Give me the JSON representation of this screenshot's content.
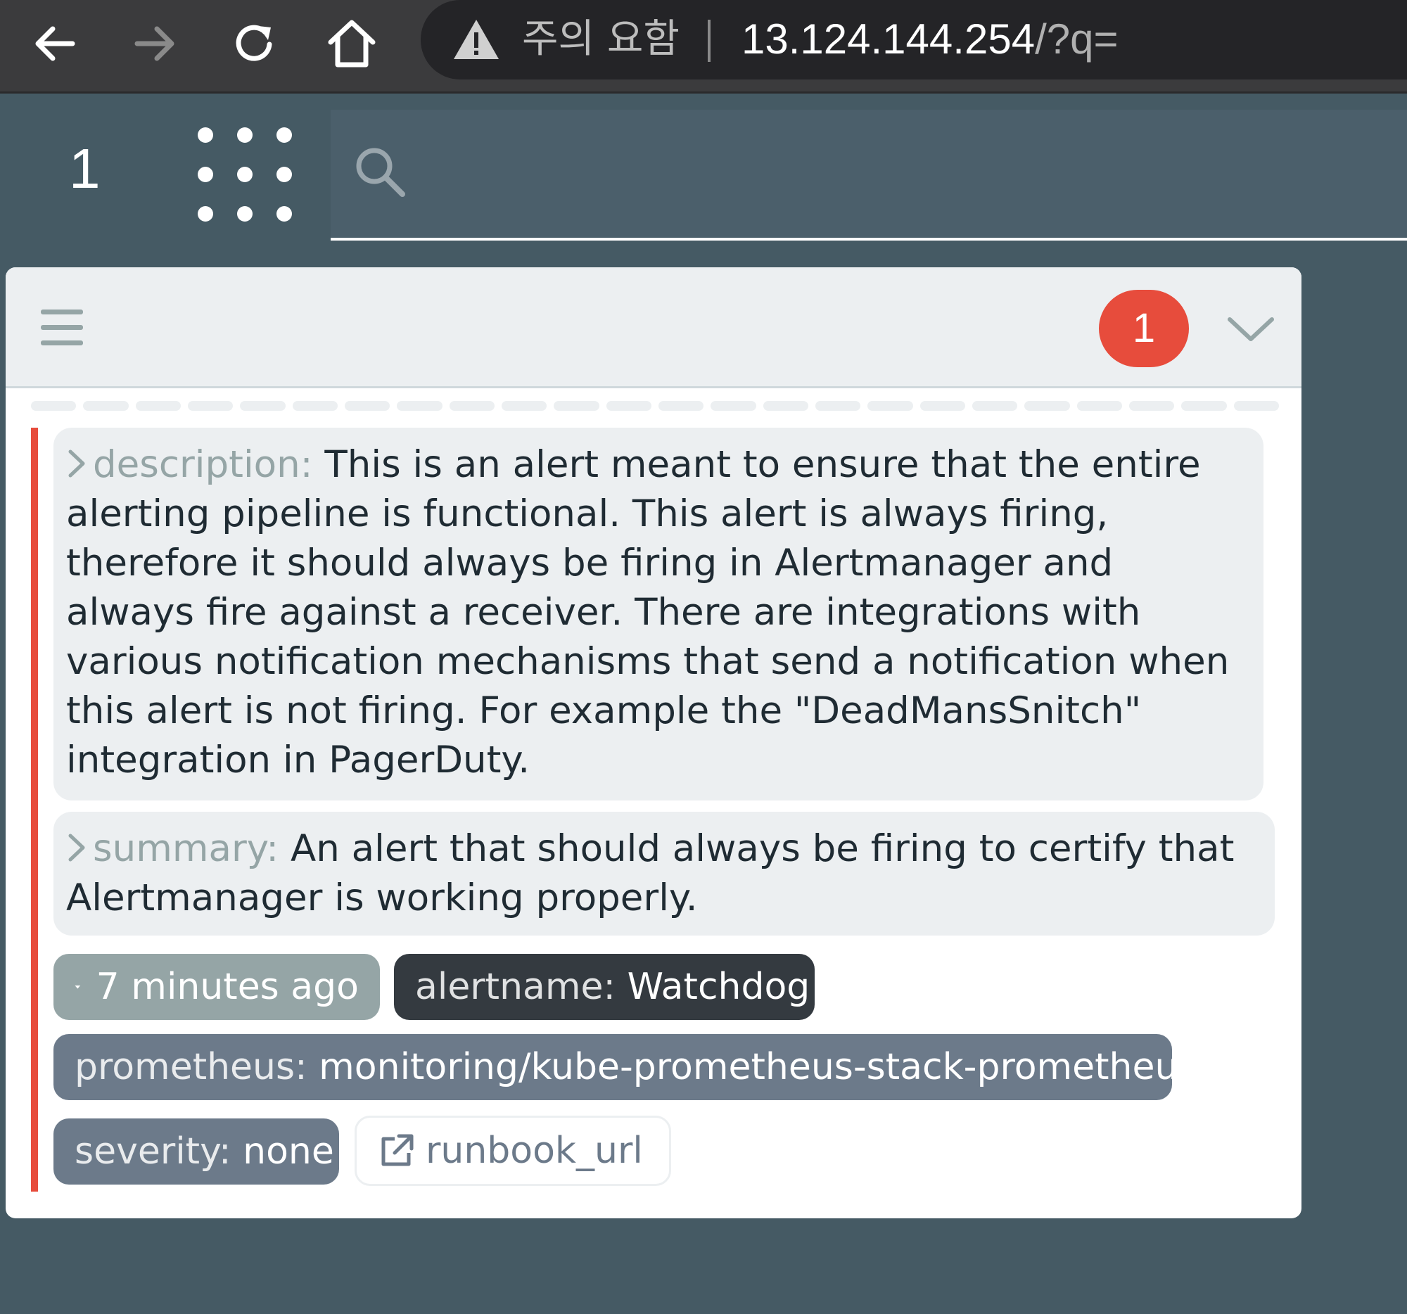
{
  "browser": {
    "security_warning": "주의 요함",
    "url_host": "13.124.144.254",
    "url_path": "/?q="
  },
  "navbar": {
    "alert_count": "1",
    "search_placeholder": ""
  },
  "group": {
    "count_badge": "1"
  },
  "alert": {
    "annotations": [
      {
        "key": "description:",
        "value": "This is an alert meant to ensure that the entire alerting pipeline is functional. This alert is always firing, therefore it should always be firing in Alertmanager and always fire against a receiver. There are integrations with various notification mechanisms that send a notification when this alert is not firing. For example the \"DeadMansSnitch\" integration in PagerDuty."
      },
      {
        "key": "summary:",
        "value": "An alert that should always be firing to certify that Alertmanager is working properly."
      }
    ],
    "started": "7 minutes ago",
    "labels": {
      "alertname_key": "alertname:",
      "alertname_value": "Watchdog",
      "prometheus_key": "prometheus:",
      "prometheus_value": "monitoring/kube-prometheus-stack-prometheus",
      "severity_key": "severity:",
      "severity_value": "none"
    },
    "link_label": "runbook_url"
  },
  "colors": {
    "page_background": "#455a64",
    "firing": "#e74c3c",
    "label_dark": "#343a40",
    "label_slate": "#6c7a8a",
    "label_muted": "#95a5a6"
  },
  "icons": [
    "back-icon",
    "forward-icon",
    "reload-icon",
    "home-icon",
    "warning-icon",
    "grid-icon",
    "search-icon",
    "menu-icon",
    "chevron-down-icon",
    "chevron-right-icon",
    "caret-down-icon",
    "external-link-icon"
  ]
}
